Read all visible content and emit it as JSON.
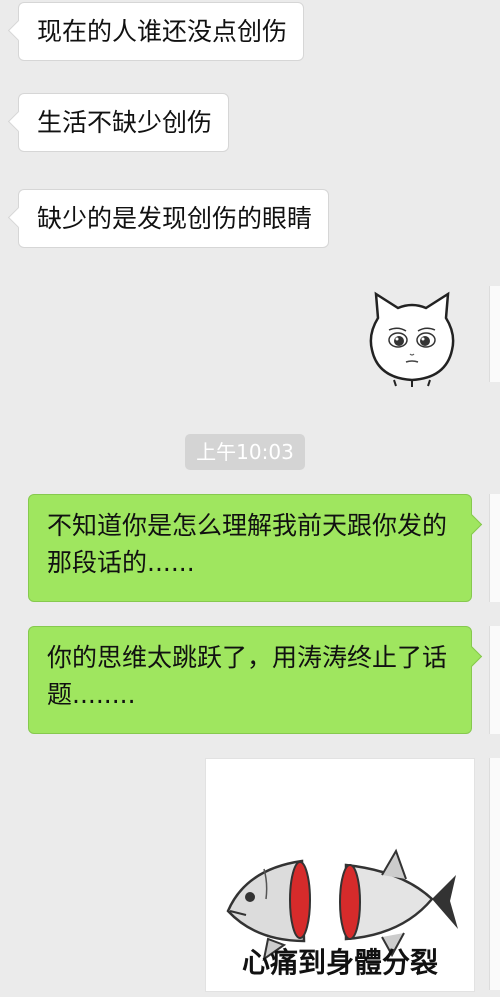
{
  "messages": {
    "m1": "现在的人谁还没点创伤",
    "m2": "生活不缺少创伤",
    "m3": "缺少的是发现创伤的眼睛",
    "timestamp": "上午10:03",
    "m4": "不知道你是怎么理解我前天跟你发的那段话的......",
    "m5": "你的思维太跳跃了，用涛涛终止了话题........"
  },
  "stickers": {
    "cat_face": "cat-face-sticker",
    "fish_caption": "心痛到身體分裂"
  },
  "colors": {
    "background": "#ebebeb",
    "incoming_bubble": "#ffffff",
    "outgoing_bubble": "#9fe65f",
    "timestamp_bg": "#d4d4d4"
  }
}
